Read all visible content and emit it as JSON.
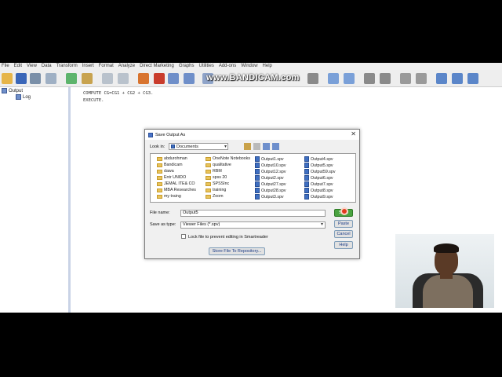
{
  "menu": [
    "File",
    "Edit",
    "View",
    "Data",
    "Transform",
    "Insert",
    "Format",
    "Analyze",
    "Direct Marketing",
    "Graphs",
    "Utilities",
    "Add-ons",
    "Window",
    "Help"
  ],
  "watermark": "www.BANDICAM.com",
  "outline": {
    "root": "Output",
    "child": "Log"
  },
  "syntax": {
    "line1": "COMPUTE CG=CG1 + CG2 + CG3.",
    "line2": "EXECUTE."
  },
  "dialog": {
    "title": "Save Output As",
    "lookin_label": "Look in:",
    "lookin_value": "Documents",
    "files": {
      "col1": [
        "abdurohman",
        "Bandicam",
        "dawa",
        "Entr UNIDO",
        "JEMAL ITE& CO",
        "MBA Researches",
        "my traing"
      ],
      "col2": [
        "OneNote Notebooks",
        "qualitative",
        "RBM",
        "spss 20",
        "SPSSInc",
        "training",
        "Zoom"
      ],
      "col3": [
        "Output1.spv",
        "Output10.spv",
        "Output12.spv",
        "Output2.spv",
        "Output27.spv",
        "Output28.spv",
        "Output3.spv"
      ],
      "col4": [
        "Output4.spv",
        "Output5.spv",
        "Output59.spv",
        "Output6.spv",
        "Output7.spv",
        "Output8.spv",
        "Output9.spv"
      ]
    },
    "filename_label": "File name:",
    "filename_value": "Output5",
    "saveas_label": "Save as type:",
    "saveas_value": "Viewer Files (*.spv)",
    "lock_label": "Lock file to prevent editing in Smartreader",
    "buttons": {
      "save": "Save",
      "paste": "Paste",
      "cancel": "Cancel",
      "help": "Help",
      "repository": "Store File To Repository..."
    }
  },
  "colors": {
    "accent": "#4a74c9",
    "save_button": "#4aa340",
    "cursor": "#e23a1e"
  }
}
